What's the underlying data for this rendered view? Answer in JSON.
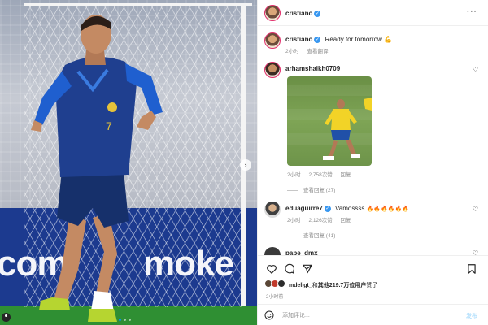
{
  "post": {
    "author": "cristiano",
    "verified": true
  },
  "caption": {
    "username": "cristiano",
    "text": "Ready for tomorrow 💪",
    "time": "2小时",
    "translate": "查看翻译"
  },
  "comments": [
    {
      "username": "arhamshaikh0709",
      "time": "2小时",
      "likes": "2,758次赞",
      "reply": "回复",
      "view_replies": "查看回复 (27)"
    },
    {
      "username": "eduaguirre7",
      "text": "Vamossss",
      "emojis": "🔥🔥🔥🔥🔥🔥",
      "time": "2小时",
      "likes": "2,126次赞",
      "reply": "回复",
      "view_replies": "查看回复 (41)"
    },
    {
      "username": "pape_dmx"
    }
  ],
  "likes_summary": {
    "user": "mdeligt_",
    "connector": "和",
    "others": "其他219.7万位用户",
    "suffix": "赞了"
  },
  "post_time": "2小时前",
  "add_comment": {
    "placeholder": "添加评论...",
    "post_label": "发布"
  },
  "photo": {
    "banner_left": "com",
    "banner_right": "moke"
  },
  "colors": {
    "verified": "#3897f0",
    "jersey": "#1f3f8f",
    "accent": "#0095f6"
  },
  "icons": [
    "more-icon",
    "heart-icon",
    "comment-icon",
    "share-icon",
    "bookmark-icon",
    "emoji-icon",
    "chevron-right-icon",
    "tagged-user-icon"
  ]
}
